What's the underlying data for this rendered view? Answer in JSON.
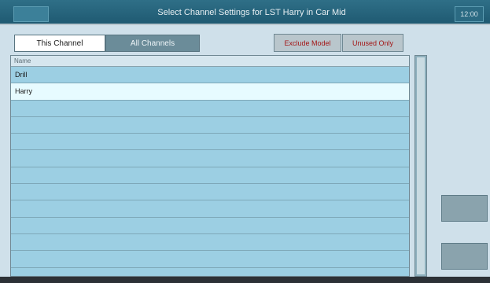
{
  "header": {
    "title": "Select Channel Settings for LST Harry in Car Mid",
    "left_label": "",
    "right_label": "12:00"
  },
  "tabs": [
    {
      "label": "This Channel",
      "active": true
    },
    {
      "label": "All Channels",
      "active": false
    }
  ],
  "actions": {
    "exclude_label": "Exclude Model",
    "unused_label": "Unused Only"
  },
  "list": {
    "header": "Name",
    "rows": [
      {
        "label": "Drill",
        "selected": false
      },
      {
        "label": "Harry",
        "selected": true
      },
      {
        "label": "",
        "selected": false
      },
      {
        "label": "",
        "selected": false
      },
      {
        "label": "",
        "selected": false
      },
      {
        "label": "",
        "selected": false
      },
      {
        "label": "",
        "selected": false
      },
      {
        "label": "",
        "selected": false
      },
      {
        "label": "",
        "selected": false
      },
      {
        "label": "",
        "selected": false
      },
      {
        "label": "",
        "selected": false
      },
      {
        "label": "",
        "selected": false
      }
    ]
  },
  "side_buttons": [
    {
      "label": ""
    },
    {
      "label": ""
    }
  ],
  "colors": {
    "accent": "#1f5a72",
    "list_bg": "#9ccfe3",
    "selected_bg": "#e7fbff",
    "danger_text": "#a31616"
  }
}
